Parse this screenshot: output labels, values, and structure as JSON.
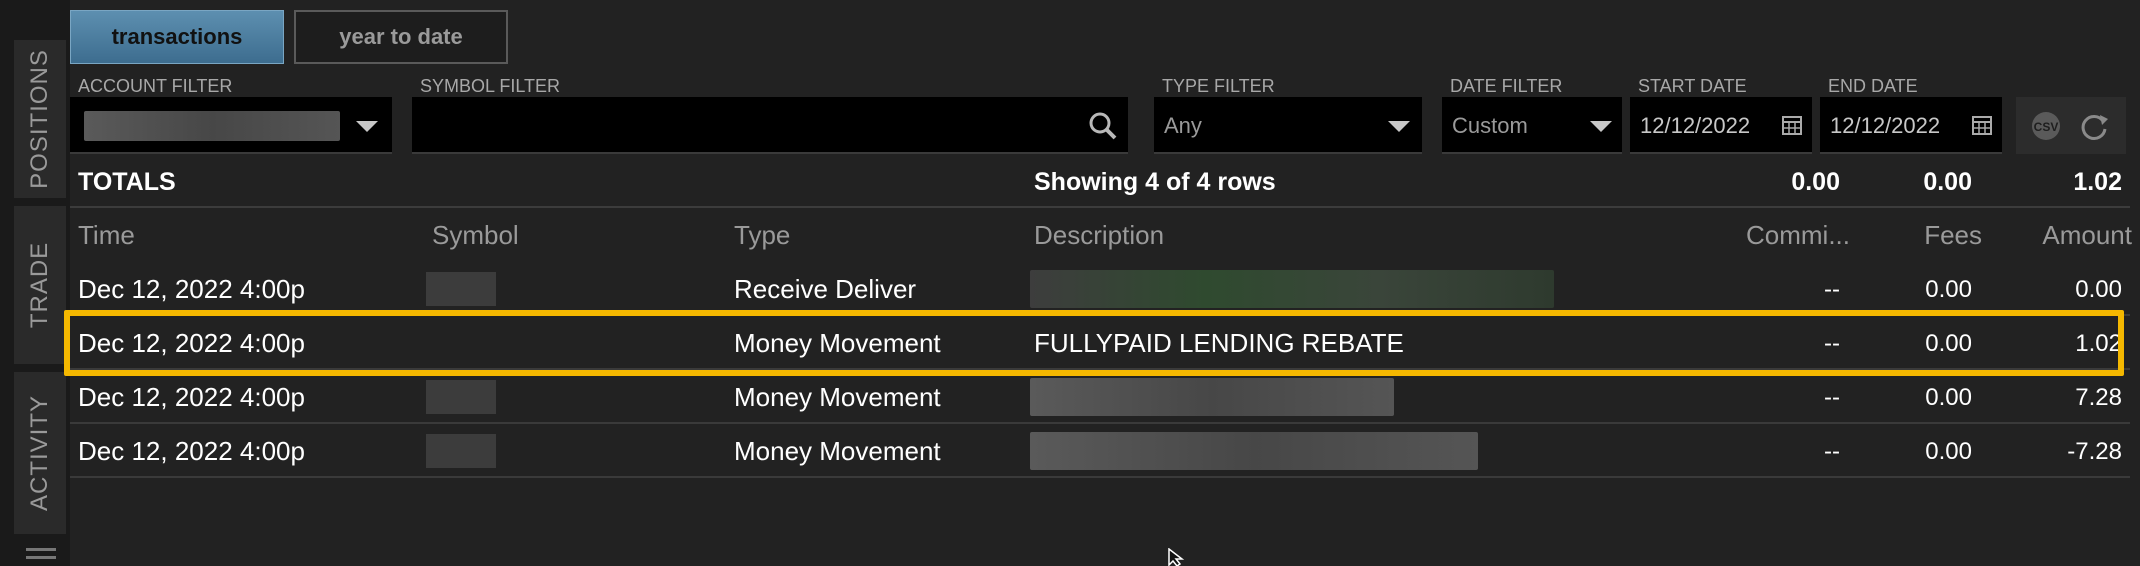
{
  "sidebar": {
    "tabs": [
      {
        "label": "POSITIONS"
      },
      {
        "label": "TRADE"
      },
      {
        "label": "ACTIVITY"
      }
    ]
  },
  "tabs": {
    "transactions": "transactions",
    "ytd": "year to date"
  },
  "filters": {
    "account_label": "ACCOUNT FILTER",
    "symbol_label": "SYMBOL FILTER",
    "symbol_value": "",
    "type_label": "TYPE FILTER",
    "type_value": "Any",
    "date_label": "DATE FILTER",
    "date_value": "Custom",
    "start_label": "START DATE",
    "start_value": "12/12/2022",
    "end_label": "END DATE",
    "end_value": "12/12/2022"
  },
  "totals": {
    "label": "TOTALS",
    "showing": "Showing 4 of 4 rows",
    "commission": "0.00",
    "fees": "0.00",
    "amount": "1.02"
  },
  "columns": {
    "time": "Time",
    "symbol": "Symbol",
    "type": "Type",
    "description": "Description",
    "commission": "Commi...",
    "fees": "Fees",
    "amount": "Amount"
  },
  "rows": [
    {
      "time": "Dec 12, 2022  4:00p",
      "type": "Receive Deliver",
      "description": "",
      "commission": "--",
      "fees": "0.00",
      "amount": "0.00"
    },
    {
      "time": "Dec 12, 2022  4:00p",
      "type": "Money Movement",
      "description": "FULLYPAID LENDING REBATE",
      "commission": "--",
      "fees": "0.00",
      "amount": "1.02"
    },
    {
      "time": "Dec 12, 2022  4:00p",
      "type": "Money Movement",
      "description": "",
      "commission": "--",
      "fees": "0.00",
      "amount": "7.28"
    },
    {
      "time": "Dec 12, 2022  4:00p",
      "type": "Money Movement",
      "description": "",
      "commission": "--",
      "fees": "0.00",
      "amount": "-7.28"
    }
  ],
  "colors": {
    "highlight": "#f5b800",
    "active_tab": "#4a7ea2"
  }
}
